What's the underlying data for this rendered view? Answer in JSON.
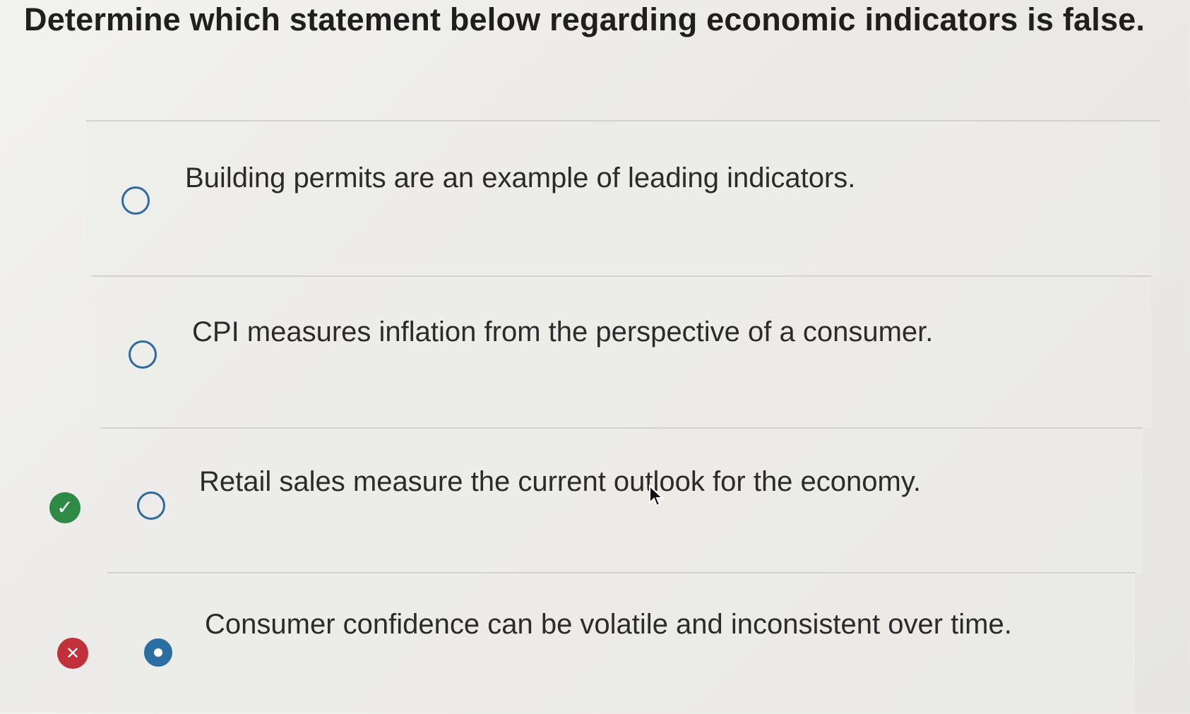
{
  "question": {
    "text": "Determine which statement below regarding economic indicators is false."
  },
  "options": [
    {
      "label": "Building permits are an example of leading indicators.",
      "selected": false,
      "feedback": null
    },
    {
      "label": "CPI measures inflation from the perspective of a consumer.",
      "selected": false,
      "feedback": null
    },
    {
      "label": "Retail sales measure the current outlook for the economy.",
      "selected": false,
      "feedback": "correct",
      "feedback_icon": "checkmark-icon"
    },
    {
      "label": "Consumer confidence can be volatile and inconsistent over time.",
      "selected": true,
      "feedback": "incorrect",
      "feedback_icon": "x-icon"
    }
  ],
  "colors": {
    "radio_accent": "#2a6ea2",
    "correct_badge": "#2e8a45",
    "incorrect_badge": "#c2303a"
  }
}
